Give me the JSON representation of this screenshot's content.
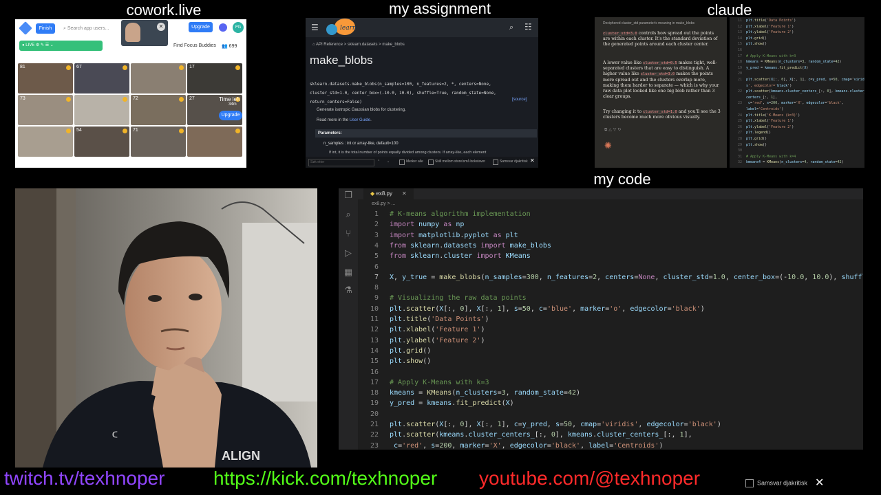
{
  "labels": {
    "cowork": "cowork.live",
    "assignment": "my assignment",
    "claude": "claude",
    "code": "my code"
  },
  "cowork": {
    "finish": "Finish",
    "search_placeholder": "Search app users...",
    "upgrade": "Upgrade",
    "avatar_initials": "PG",
    "live": "LIVE",
    "find_buddies": "Find Focus Buddies",
    "count": "699",
    "tiles": [
      "81",
      "67",
      "",
      "17",
      "73",
      "",
      "72",
      "27",
      "",
      "54",
      "71",
      ""
    ],
    "time_left": "Time left",
    "time_value": "34m",
    "upgrade2": "Upgrade"
  },
  "assignment": {
    "breadcrumbs": "API Reference  >  sklearn.datasets  >  make_blobs",
    "title": "make_blobs",
    "signature_l1": "sklearn.datasets.make_blobs(n_samples=100, n_features=2, *, centers=None,",
    "signature_l2": "cluster_std=1.0, center_box=(-10.0, 10.0), shuffle=True, random_state=None,",
    "signature_l3": "return_centers=False)",
    "source": "[source]",
    "desc": "Generate isotropic Gaussian blobs for clustering.",
    "more_prefix": "Read more in the",
    "more_link": "User Guide",
    "params_header": "Parameters:",
    "n_samples": "n_samples : int or array-like, default=100",
    "n_samples_desc": "If int, it is the total number of points equally divided among clusters. If array-like, each element",
    "find_placeholder": "Søk etter",
    "opt1": "Merker alle",
    "opt2": "Skill mellom store/små bokstaver",
    "opt3": "Samsvar djakritisk"
  },
  "claude": {
    "heading": "Deciphered cluster_std parameter's meaning in make_blobs",
    "p1_code": "cluster_std=3.0",
    "p1": "controls how spread out the points are within each cluster. It's the standard deviation of the generated points around each cluster center.",
    "p2_a": "A lower value like",
    "p2_code1": "cluster_std=0.5",
    "p2_b": "makes tight, well-separated clusters that are easy to distinguish. A higher value like",
    "p2_code2": "cluster_std=3.0",
    "p2_c": "makes the points more spread out and the clusters overlap more, making them harder to separate — which is why your raw data plot looked like one big blob rather than 3 clear groups.",
    "p3_a": "Try changing it to",
    "p3_code": "cluster_std=1.0",
    "p3_b": "and you'll see the 3 clusters become much more obvious visually.",
    "code_lines": [
      {
        "n": "11",
        "t": "plt.title('Data Points')"
      },
      {
        "n": "12",
        "t": "plt.xlabel('Feature 1')"
      },
      {
        "n": "13",
        "t": "plt.ylabel('Feature 2')"
      },
      {
        "n": "14",
        "t": "plt.grid()"
      },
      {
        "n": "15",
        "t": "plt.show()"
      },
      {
        "n": "16",
        "t": ""
      },
      {
        "n": "17",
        "t": "# Apply K-Means with k=3"
      },
      {
        "n": "18",
        "t": "kmeans = KMeans(n_clusters=3, random_state=42)"
      },
      {
        "n": "19",
        "t": "y_pred = kmeans.fit_predict(X)"
      },
      {
        "n": "20",
        "t": ""
      },
      {
        "n": "21",
        "t": "plt.scatter(X[:, 0], X[:, 1], c=y_pred, s=50, cmap='viridi"
      },
      {
        "n": "",
        "t": "s', edgecolor='black')"
      },
      {
        "n": "22",
        "t": "plt.scatter(kmeans.cluster_centers_[:, 0], kmeans.cluster_"
      },
      {
        "n": "",
        "t": "centers_[:, 1],"
      },
      {
        "n": "23",
        "t": "           c='red', s=200, marker='X', edgecolor='black',"
      },
      {
        "n": "",
        "t": "label='Centroids')"
      },
      {
        "n": "24",
        "t": "plt.title('K-Means (k=3)')"
      },
      {
        "n": "25",
        "t": "plt.xlabel('Feature 1')"
      },
      {
        "n": "26",
        "t": "plt.ylabel('Feature 2')"
      },
      {
        "n": "27",
        "t": "plt.legend()"
      },
      {
        "n": "28",
        "t": "plt.grid()"
      },
      {
        "n": "29",
        "t": "plt.show()"
      },
      {
        "n": "30",
        "t": ""
      },
      {
        "n": "31",
        "t": "# Apply K-Means with k=4"
      },
      {
        "n": "32",
        "t": "kmeans4 = KMeans(n_clusters=4, random_state=42)"
      }
    ]
  },
  "vscode": {
    "tab": "ex8.py",
    "breadcrumb": "ex8.py > ...",
    "lines": [
      {
        "n": "1",
        "t": "# K-means algorithm implementation",
        "k": "comment"
      },
      {
        "n": "2",
        "t": "import numpy as np"
      },
      {
        "n": "3",
        "t": "import matplotlib.pyplot as plt"
      },
      {
        "n": "4",
        "t": "from sklearn.datasets import make_blobs"
      },
      {
        "n": "5",
        "t": "from sklearn.cluster import KMeans"
      },
      {
        "n": "6",
        "t": ""
      },
      {
        "n": "7",
        "t": "X, y_true = make_blobs(n_samples=300, n_features=2, centers=None, cluster_std=1.0, center_box=(-10.0, 10.0), shuffle=True, r",
        "active": true
      },
      {
        "n": "8",
        "t": ""
      },
      {
        "n": "9",
        "t": "# Visualizing the raw data points",
        "k": "comment"
      },
      {
        "n": "10",
        "t": "plt.scatter(X[:, 0], X[:, 1], s=50, c='blue', marker='o', edgecolor='black')"
      },
      {
        "n": "11",
        "t": "plt.title('Data Points')"
      },
      {
        "n": "12",
        "t": "plt.xlabel('Feature 1')"
      },
      {
        "n": "13",
        "t": "plt.ylabel('Feature 2')"
      },
      {
        "n": "14",
        "t": "plt.grid()"
      },
      {
        "n": "15",
        "t": "plt.show()"
      },
      {
        "n": "16",
        "t": ""
      },
      {
        "n": "17",
        "t": "# Apply K-Means with k=3",
        "k": "comment"
      },
      {
        "n": "18",
        "t": "kmeans = KMeans(n_clusters=3, random_state=42)"
      },
      {
        "n": "19",
        "t": "y_pred = kmeans.fit_predict(X)"
      },
      {
        "n": "20",
        "t": ""
      },
      {
        "n": "21",
        "t": "plt.scatter(X[:, 0], X[:, 1], c=y_pred, s=50, cmap='viridis', edgecolor='black')"
      },
      {
        "n": "22",
        "t": "plt.scatter(kmeans.cluster_centers_[:, 0], kmeans.cluster_centers_[:, 1],"
      },
      {
        "n": "23",
        "t": "            c='red', s=200, marker='X', edgecolor='black', label='Centroids')"
      }
    ]
  },
  "footer": {
    "twitch": "twitch.tv/texhnoper",
    "kick": "https://kick.com/texhnoper",
    "youtube": "youtube.com/@texhnoper",
    "samsvar": "Samsvar djakritisk"
  },
  "colors": {
    "twitch": "#9146ff",
    "kick": "#53fc18",
    "youtube": "#ff2a2a",
    "keyword": "#c586c0",
    "func": "#dcdcaa",
    "string": "#ce9178",
    "number": "#b5cea8",
    "comment": "#6a9955",
    "param": "#9cdcfe"
  }
}
